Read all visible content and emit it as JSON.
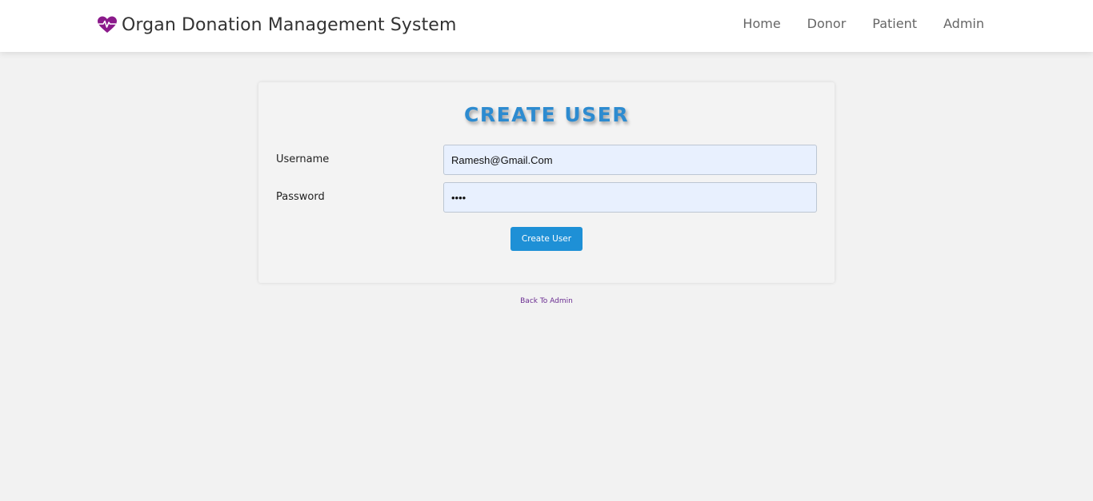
{
  "brand": {
    "title": "Organ Donation Management System",
    "icon": "heart-pulse-icon",
    "icon_color": "#8b1a8b"
  },
  "nav": {
    "items": [
      {
        "label": "Home"
      },
      {
        "label": "Donor"
      },
      {
        "label": "Patient"
      },
      {
        "label": "Admin"
      }
    ]
  },
  "form": {
    "title": "CREATE USER",
    "username_label": "Username",
    "username_value": "Ramesh@Gmail.Com",
    "password_label": "Password",
    "password_value": "••••",
    "submit_label": "Create User"
  },
  "footer": {
    "back_link": "Back To Admin"
  },
  "colors": {
    "accent": "#1e90d6",
    "title": "#2d8bd0",
    "link": "#6a2c91",
    "background": "#f2f2f2"
  }
}
